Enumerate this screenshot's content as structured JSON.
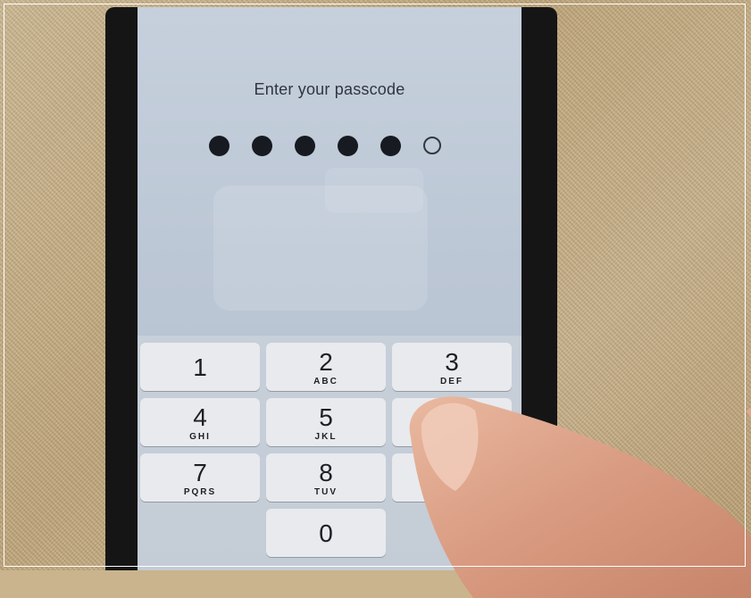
{
  "screen": {
    "title": "Enter your passcode"
  },
  "passcode": {
    "entered_digits": 5,
    "total_digits": 6
  },
  "keypad": {
    "keys": [
      {
        "digit": "1",
        "letters": ""
      },
      {
        "digit": "2",
        "letters": "ABC"
      },
      {
        "digit": "3",
        "letters": "DEF"
      },
      {
        "digit": "4",
        "letters": "GHI"
      },
      {
        "digit": "5",
        "letters": "JKL"
      },
      {
        "digit": "7",
        "letters": "PQRS"
      },
      {
        "digit": "8",
        "letters": "TUV"
      },
      {
        "digit": "0",
        "letters": ""
      }
    ],
    "backspace_icon": "backspace-icon"
  }
}
